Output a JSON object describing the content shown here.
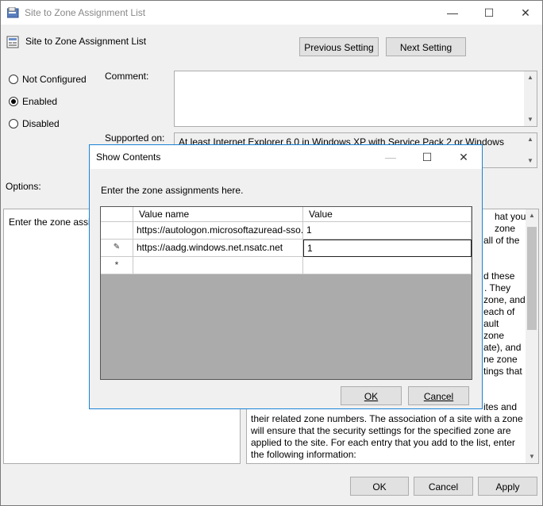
{
  "window": {
    "title": "Site to Zone Assignment List",
    "policy_name": "Site to Zone Assignment List",
    "prev_button": "Previous Setting",
    "next_button": "Next Setting"
  },
  "state_options": {
    "not_configured": "Not Configured",
    "enabled": "Enabled",
    "disabled": "Disabled",
    "selected": "Enabled"
  },
  "comment": {
    "label": "Comment:",
    "value": ""
  },
  "supported": {
    "label": "Supported on:",
    "value": "At least Internet Explorer 6.0 in Windows XP with Service Pack 2 or Windows"
  },
  "options": {
    "label": "Options:",
    "text": "Enter the zone assig"
  },
  "help": {
    "line1": "hat you",
    "line2": "zone",
    "line3": "all of the",
    "line4": "d these",
    "line5": ". They",
    "line6": "zone, and",
    "line7": "each of",
    "line8": "ault",
    "line9": "zone",
    "line10": "ate), and",
    "line11": "ne zone",
    "line12": "tings that",
    "line13": "ites and",
    "line14": "their related zone numbers. The association of a site with a zone",
    "line15": "will ensure that the security settings for the specified zone are",
    "line16": "applied to the site.  For each entry that you add to the list, enter",
    "line17": "the following information:"
  },
  "footer": {
    "ok": "OK",
    "cancel": "Cancel",
    "apply": "Apply"
  },
  "dialog": {
    "title": "Show Contents",
    "instruction": "Enter the zone assignments here.",
    "columns": [
      "Value name",
      "Value"
    ],
    "rows": [
      {
        "marker": "",
        "name": "https://autologon.microsoftazuread-sso.c...",
        "value": "1"
      },
      {
        "marker": "✎",
        "name": "https://aadg.windows.net.nsatc.net",
        "value": "1"
      },
      {
        "marker": "*",
        "name": "",
        "value": ""
      }
    ],
    "ok": "OK",
    "cancel": "Cancel"
  }
}
